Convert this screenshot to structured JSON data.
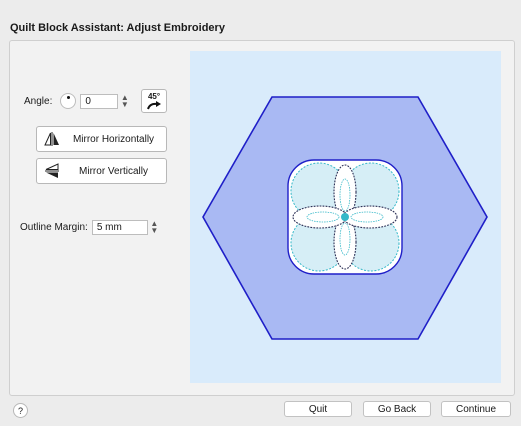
{
  "window": {
    "title": "Quilt Block Assistant: Adjust Embroidery"
  },
  "angle": {
    "label": "Angle:",
    "value": "0",
    "rotate_button_label": "45°"
  },
  "mirror": {
    "horizontal_label": "Mirror Horizontally",
    "vertical_label": "Mirror Vertically"
  },
  "outline_margin": {
    "label": "Outline Margin:",
    "value": "5 mm"
  },
  "footer": {
    "help_label": "?",
    "quit_label": "Quit",
    "go_back_label": "Go Back",
    "continue_label": "Continue"
  },
  "colors": {
    "canvas_bg": "#d9ebfb",
    "hexagon_fill": "#a9b9f3",
    "hexagon_stroke": "#1f1fc8",
    "design_fill": "#d6eef6",
    "stitch_teal": "#35b8c8",
    "stitch_dark": "#2b2f55"
  },
  "icons": {
    "dial": "angle-dial-icon",
    "rotate": "rotate-45-icon",
    "mirror_h": "mirror-horizontal-icon",
    "mirror_v": "mirror-vertical-icon",
    "help": "help-icon"
  }
}
